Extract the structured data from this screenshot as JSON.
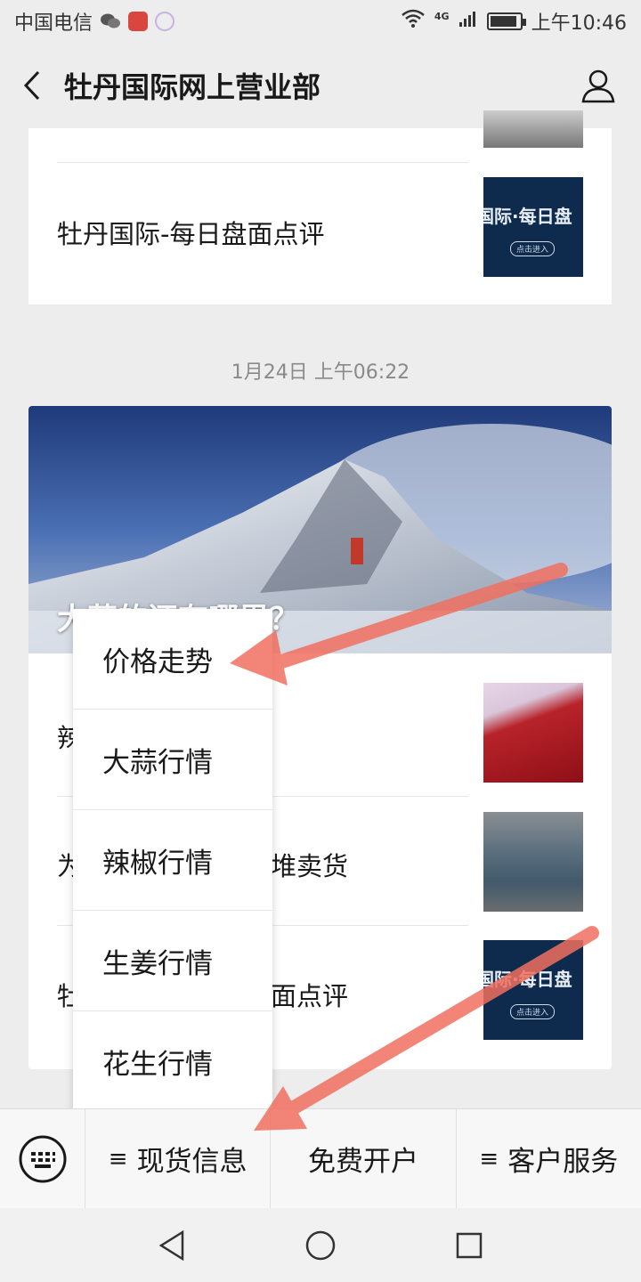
{
  "status_bar": {
    "carrier": "中国电信",
    "network": "4G",
    "battery_level": 0.9,
    "time": "上午10:46"
  },
  "nav": {
    "title": "牡丹国际网上营业部",
    "back_icon": "chevron-left-icon",
    "profile_icon": "person-icon"
  },
  "feed": {
    "top_card": {
      "article": "牡丹国际-每日盘面点评"
    },
    "timestamp": "1月24日 上午06:22",
    "main_card": {
      "hero_title": "大蒜的还有哪里？",
      "articles": [
        {
          "title": "辣"
        },
        {
          "title": "为",
          "tail": "堆卖货"
        },
        {
          "title": "牡",
          "tail": "面点评"
        }
      ],
      "thumb_text": "国际·每日盘",
      "thumb_button": "点击进入"
    }
  },
  "popup_menu": {
    "items": [
      "价格走势",
      "大蒜行情",
      "辣椒行情",
      "生姜行情",
      "花生行情"
    ]
  },
  "bottom_menu": {
    "keyboard_icon": "keyboard-icon",
    "items": [
      {
        "glyph": "≡",
        "label": "现货信息"
      },
      {
        "glyph": "",
        "label": "免费开户"
      },
      {
        "glyph": "≡",
        "label": "客户服务"
      }
    ]
  },
  "annotation_color": "#f07060"
}
